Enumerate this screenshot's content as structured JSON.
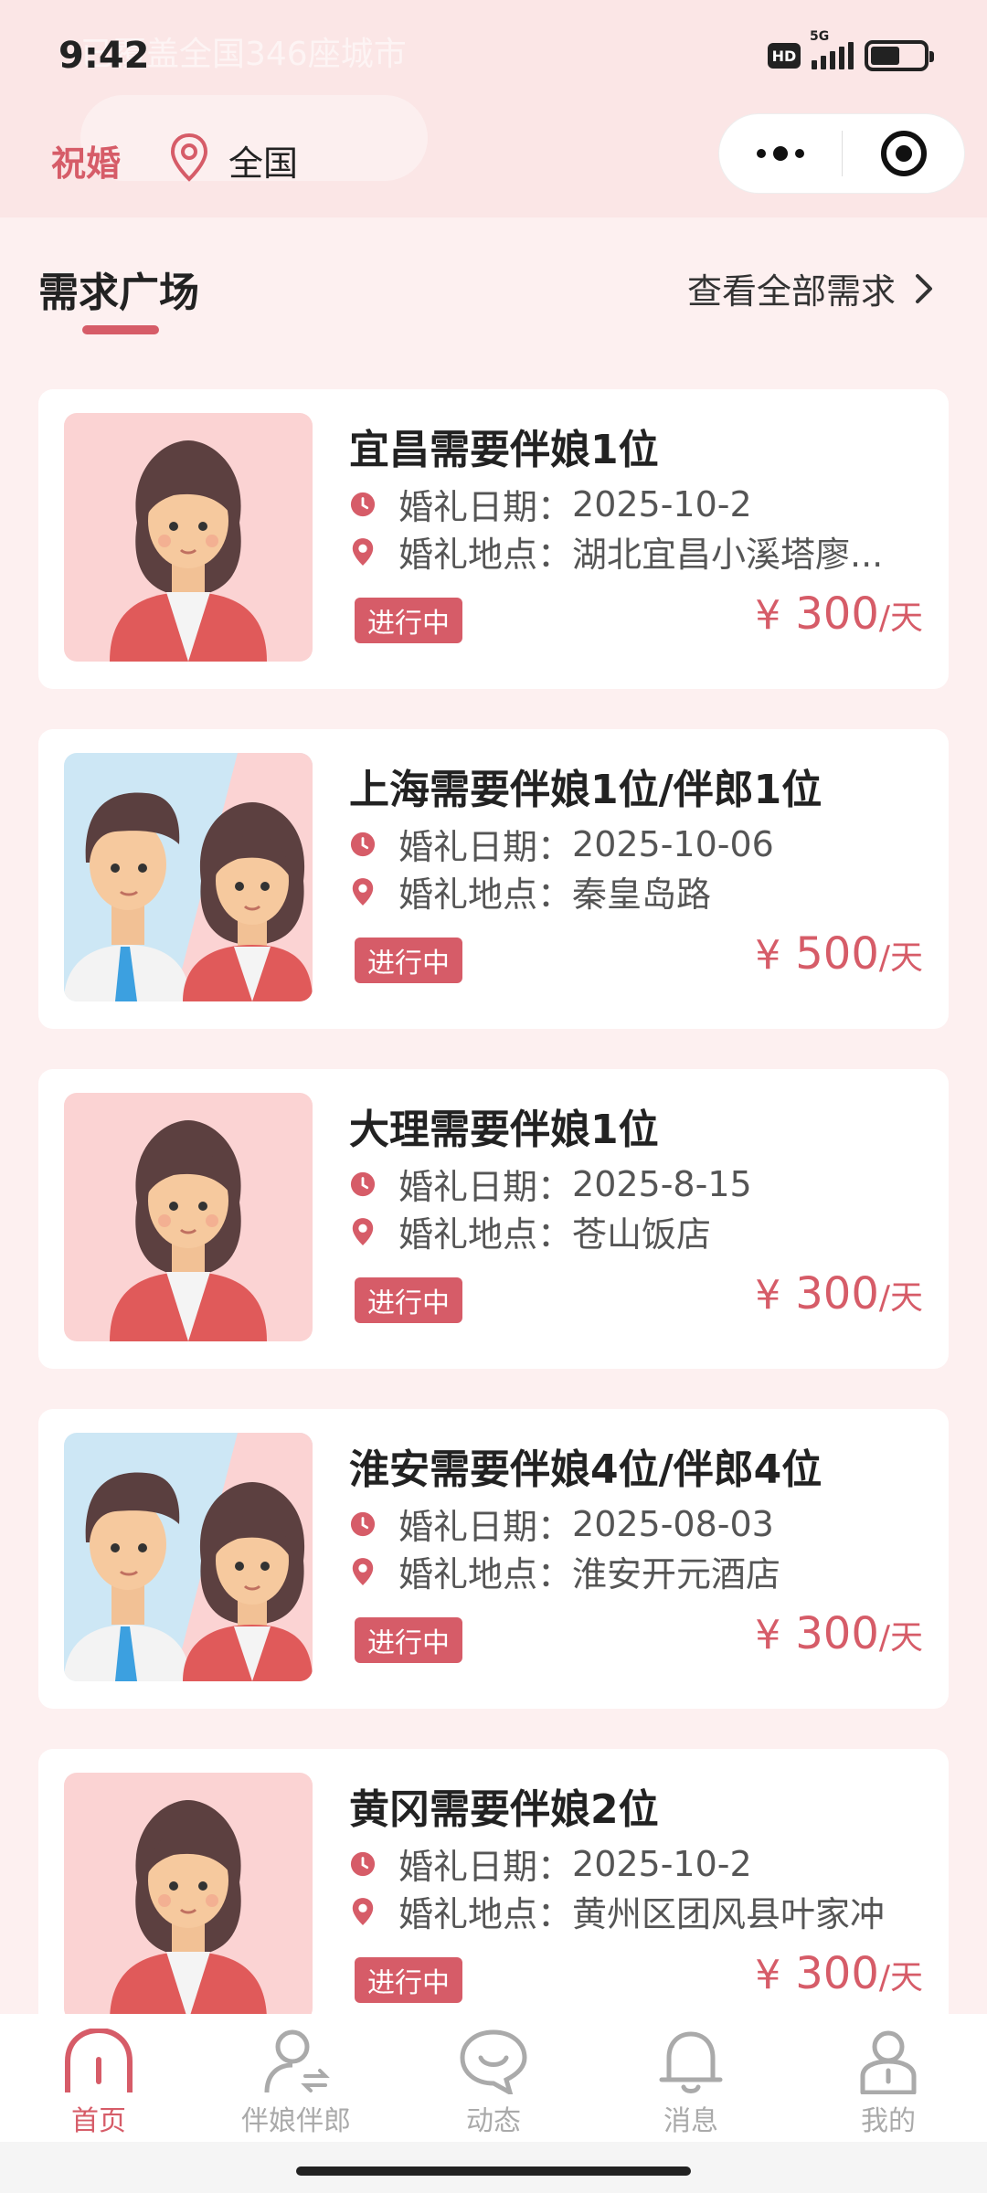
{
  "status_bar": {
    "time": "9:42",
    "network": "5G",
    "hd": "HD"
  },
  "header": {
    "brand": "祝婚",
    "location": "全国",
    "background_hint": "已覆盖全国346座城市"
  },
  "section": {
    "title": "需求广场",
    "see_all": "查看全部需求"
  },
  "labels": {
    "date_label": "婚礼日期：",
    "place_label": "婚礼地点："
  },
  "cards": [
    {
      "title": "宜昌需要伴娘1位",
      "date": "2025-10-2",
      "place": "湖北宜昌小溪塔廖...",
      "status": "进行中",
      "currency": "¥",
      "price": "300",
      "unit": "/天",
      "avatar": "bridesmaid"
    },
    {
      "title": "上海需要伴娘1位/伴郎1位",
      "date": "2025-10-06",
      "place": "秦皇岛路",
      "status": "进行中",
      "currency": "¥",
      "price": "500",
      "unit": "/天",
      "avatar": "couple"
    },
    {
      "title": "大理需要伴娘1位",
      "date": "2025-8-15",
      "place": "苍山饭店",
      "status": "进行中",
      "currency": "¥",
      "price": "300",
      "unit": "/天",
      "avatar": "bridesmaid"
    },
    {
      "title": "淮安需要伴娘4位/伴郎4位",
      "date": "2025-08-03",
      "place": "淮安开元酒店",
      "status": "进行中",
      "currency": "¥",
      "price": "300",
      "unit": "/天",
      "avatar": "couple"
    },
    {
      "title": "黄冈需要伴娘2位",
      "date": "2025-10-2",
      "place": "黄州区团风县叶家冲",
      "status": "进行中",
      "currency": "¥",
      "price": "300",
      "unit": "/天",
      "avatar": "bridesmaid"
    }
  ],
  "tabbar": [
    {
      "label": "首页",
      "icon": "home-icon",
      "active": true
    },
    {
      "label": "伴娘伴郎",
      "icon": "user-swap-icon",
      "active": false
    },
    {
      "label": "动态",
      "icon": "smile-icon",
      "active": false
    },
    {
      "label": "消息",
      "icon": "bell-icon",
      "active": false
    },
    {
      "label": "我的",
      "icon": "profile-icon",
      "active": false
    }
  ],
  "colors": {
    "accent": "#d65c68",
    "background": "#fdf0f0",
    "header": "#fbe6e6"
  }
}
